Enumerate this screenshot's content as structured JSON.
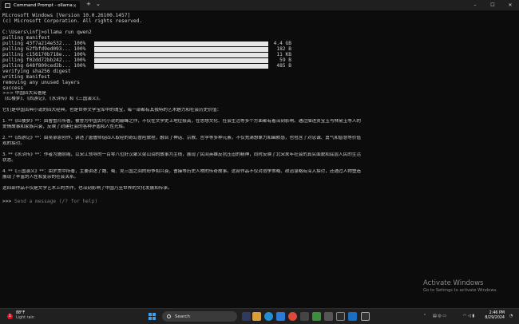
{
  "window": {
    "tab_title": "Command Prompt - ollama",
    "tab_close": "×",
    "new_tab": "+",
    "dropdown": "⌄",
    "minimize": "–",
    "maximize": "☐",
    "close": "✕"
  },
  "terminal": {
    "header_lines": [
      "Microsoft Windows [Version 10.0.26100.1457]",
      "(c) Microsoft Corporation. All rights reserved.",
      "",
      "C:\\Users\\infj>ollama run qwen2",
      "pulling manifest"
    ],
    "pulls": [
      {
        "label": "pulling 43f7a214e532... 100%",
        "size": "4.4 GB",
        "progress": 1.0
      },
      {
        "label": "pulling 62fbfd9ed093... 100%",
        "size": "182 B",
        "progress": 1.0
      },
      {
        "label": "pulling c156170b718e... 100%",
        "size": "11 KB",
        "progress": 1.0
      },
      {
        "label": "pulling f02dd72bb242... 100%",
        "size": "59 B",
        "progress": 1.0
      },
      {
        "label": "pulling 648f809ced2b... 100%",
        "size": "485 B",
        "progress": 1.0
      }
    ],
    "status_lines": [
      "verifying sha256 digest",
      "writing manifest",
      "removing any unused layers",
      "success"
    ],
    "user_prompt": ">>> 中国四大名著是",
    "response_lines": [
      "《红楼梦》、《西游记》、《水浒传》和《三国演义》。",
      "",
      "它们是中国古典小说的四大经典，也是世界文学宝库中的瑰宝，每一部都有其独特的艺术魅力和社会历史价值：",
      "",
      "1. **《红楼梦》**：由曹雪芹所著，被誉为中国古代小说的巅峰之作，不仅在文学史上地位极高，在思想文化、社会生活等多个方面都有着深刻影响。通过描述贾宝玉与林黛玉等人的",
      "爱情故事和家族兴衰，反映了封建社会的各种矛盾和人性光辉。",
      "",
      "2. **《西游记》**：由吴承恩创作，讲述了唐僧师徒四人取经的奇幻冒险旅程，融合了神话、宗教、哲学等多种元素，不仅充满想象力和幽默感，也包含了对忠诚、勇气和智慧等价值",
      "观的探讨。",
      "",
      "3. **《水浒传》**：作者为施耐庵，以宋江领导的一百零八位好汉聚义梁山泊的故事为主线，展现了民间英雄反抗压迫的精神，同时反映了北宋末年社会的真实面貌和底层人民的生活",
      "状态。",
      "",
      "4. **《三国演义》**：由罗贯中所著，主要讲述了魏、蜀、吴三国之间的纷争和兴衰，曹操等历史人物的传奇故事。这部作品不仅对战争策略、政治谋略有深入探讨，还通过人物塑造",
      "展现了丰富的人性和复杂的社会关系。",
      "",
      "这四部作品不仅是文学艺术上的杰作，也深刻影响了中国乃至世界的文化发展和传承。",
      ""
    ],
    "input_prompt": ">>> ",
    "input_placeholder": "Send a message (/? for help)"
  },
  "watermark": {
    "title": "Activate Windows",
    "subtitle": "Go to Settings to activate Windows."
  },
  "taskbar": {
    "weather_badge": "1",
    "weather_temp": "88°F",
    "weather_desc": "Light rain",
    "search_label": "Search",
    "time": "2:46 PM",
    "date": "8/29/2024"
  }
}
